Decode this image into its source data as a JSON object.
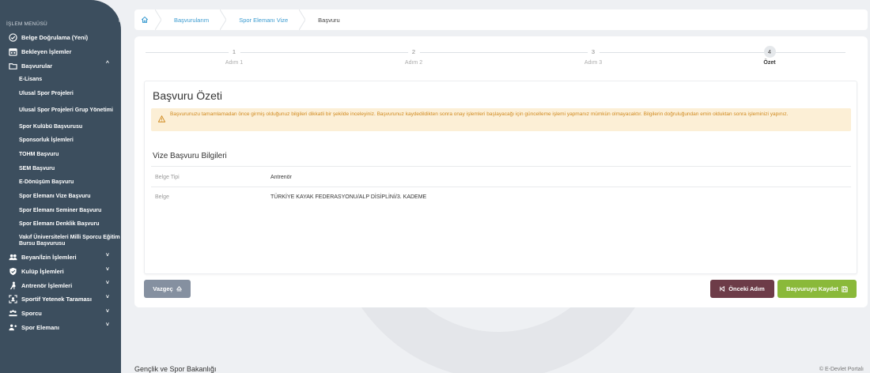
{
  "sidebar": {
    "menu_title": "İŞLEM MENÜSÜ",
    "items_top": [
      {
        "label": "Belge Doğrulama (Yeni)",
        "icon": "check-circle-icon"
      },
      {
        "label": "Bekleyen İşlemler",
        "icon": "calendar-icon"
      },
      {
        "label": "Başvurular",
        "icon": "folder-icon",
        "chevron": "^"
      }
    ],
    "sub_items": [
      "E-Lisans",
      "Ulusal Spor Projeleri",
      "Ulusal Spor Projeleri Grup Yönetimi",
      "Spor Kulübü Başvurusu",
      "Sponsorluk İşlemleri",
      "TOHM Başvuru",
      "SEM Başvuru",
      "E-Dönüşüm Başvuru",
      "Spor Elemanı Vize Başvuru",
      "Spor Elemanı Seminer Başvuru",
      "Spor Elemanı Denklik Başvuru",
      "Vakıf Üniversiteleri Milli Sporcu Eğitim Bursu Başvurusu"
    ],
    "items_bottom": [
      {
        "label": "Beyan/İzin İşlemleri",
        "icon": "users-icon",
        "chevron": "˅"
      },
      {
        "label": "Kulüp İşlemleri",
        "icon": "shield-icon",
        "chevron": "˅"
      },
      {
        "label": "Antrenör İşlemleri",
        "icon": "coach-icon",
        "chevron": "˅"
      },
      {
        "label": "Sportif Yetenek Taraması",
        "icon": "scan-icon",
        "chevron": "˅"
      },
      {
        "label": "Sporcu",
        "icon": "athletes-icon",
        "chevron": "˅"
      },
      {
        "label": "Spor Elemanı",
        "icon": "staff-icon",
        "chevron": "˅"
      }
    ]
  },
  "breadcrumb": {
    "items": [
      "Başvurularım",
      "Spor Elemanı Vize",
      "Başvuru"
    ]
  },
  "steps": [
    {
      "num": "1",
      "label": "Adım 1"
    },
    {
      "num": "2",
      "label": "Adım 2"
    },
    {
      "num": "3",
      "label": "Adım 3"
    },
    {
      "num": "4",
      "label": "Özet"
    }
  ],
  "summary": {
    "title": "Başvuru Özeti",
    "warning": "Başvurunuzu tamamlamadan önce girmiş olduğunuz bilgileri dikkatli bir şekilde inceleyiniz. Başvurunuz kaydedildikten sonra onay işlemleri başlayacağı için güncelleme işlemi yapmanız mümkün olmayacaktır. Bilgilerin doğruluğundan emin olduktan sonra işleminizi yapınız.",
    "section_title": "Vize Başvuru Bilgileri",
    "rows": [
      {
        "label": "Belge Tipi",
        "value": "Antrenör"
      },
      {
        "label": "Belge",
        "value": "TÜRKİYE KAYAK FEDERASYONU/ALP DİSİPLİNİ/3. KADEME"
      }
    ]
  },
  "buttons": {
    "cancel": "Vazgeç",
    "prev": "Önceki Adım",
    "save": "Başvuruyu Kaydet"
  },
  "footer": {
    "left": "Gençlik ve Spor Bakanlığı",
    "right": "© E-Devlet Portalı"
  },
  "colors": {
    "sidebar": "#3c4e5e",
    "link": "#3a9bd0",
    "warning_bg": "#fcefd6",
    "warning_text": "#d08a20",
    "cancel": "#8590a0",
    "prev": "#6d3c48",
    "save": "#8ab93a"
  }
}
